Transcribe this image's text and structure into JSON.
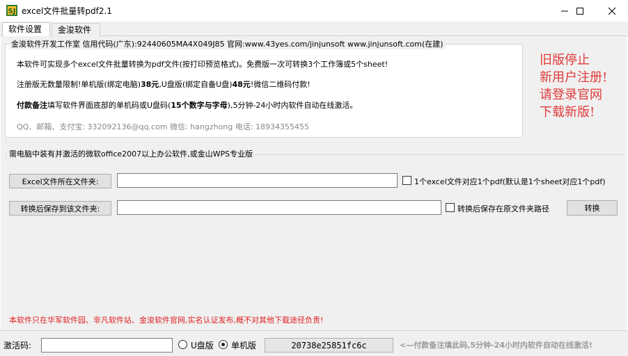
{
  "window": {
    "title": "excel文件批量转pdf2.1",
    "icon": "app-logo-icon",
    "controls": [
      "minimize-icon",
      "maximize-icon",
      "close-icon"
    ]
  },
  "tabs": [
    {
      "label": "软件设置",
      "active": true
    },
    {
      "label": "金浚软件",
      "active": false
    }
  ],
  "info_group": {
    "title": "金浚软件开发工作室 信用代码(广东):92440605MA4X049J85 官网:www.43yes.com/jinjunsoft  www.jinjunsoft.com(在建)",
    "line1": "本软件可实现多个excel文件批量转换为pdf文件(按打印预览格式)。免费版一次可转换3个工作簿或5个sheet!",
    "line2_a": "注册版无数量限制!单机版(绑定电脑)",
    "line2_b": "38元",
    "line2_c": ",U盘版(绑定自备U盘)",
    "line2_d": "48元",
    "line2_e": "!微信二维码付款!",
    "line3_a": "付款备注",
    "line3_b": "填写软件界面底部的单机码或U盘码(",
    "line3_c": "15个数字与字母",
    "line3_d": "),5分钟-24小时内软件自动在线激活。",
    "line4": "QQ、邮箱、支付宝: 332092136@qq.com   微信: hangzhong   电话: 18934355455"
  },
  "promo": {
    "lines": [
      "旧版停止",
      "新用户注册!",
      "请登录官网",
      "下载新版!"
    ],
    "color": "#e03a3a"
  },
  "requirements": {
    "title": "需电脑中装有并激活的微软office2007以上办公软件,或金山WPS专业版",
    "excel_folder_button": "Excel文件所在文件夹:",
    "excel_folder_value": "",
    "one_pdf_checkbox": "1个excel文件对应1个pdf(默认是1个sheet对应1个pdf)",
    "save_folder_button": "转换后保存到该文件夹:",
    "save_folder_value": "",
    "same_path_checkbox": "转换后保存在原文件夹路径",
    "convert_button": "转换"
  },
  "notice": "本软件只在华军软件园、非凡软件站、金浚软件官网,实名认证发布,概不对其他下载途径负责!",
  "notice_color": "#e02020",
  "bottom": {
    "activation_label": "激活码:",
    "activation_value": "",
    "usb_label": "U盘版",
    "usb_selected": false,
    "single_label": "单机版",
    "single_selected": true,
    "machine_code": "20738e25851fc6c",
    "hint": "<—付款备注填此码,5分钟-24小时内软件自动在线激活!"
  }
}
